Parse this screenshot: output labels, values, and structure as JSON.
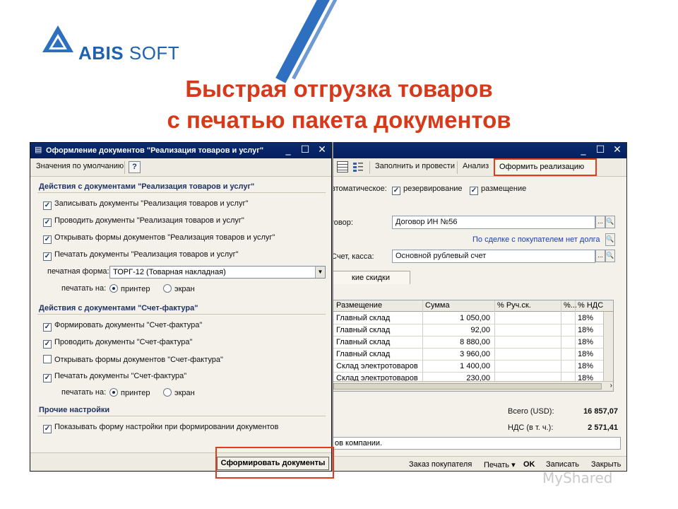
{
  "logo": {
    "brand": "ABIS",
    "suffix": "SOFT"
  },
  "slide": {
    "title_line1": "Быстрая  отгрузка товаров",
    "title_line2": "с печатью пакета документов"
  },
  "main_window": {
    "toolbar": {
      "fill_post": "Заполнить и провести",
      "analysis": "Анализ",
      "issue_sale": "Оформить реализацию"
    },
    "auto_label": "втоматическое:",
    "reserve_label": "резервирование",
    "placement_label": "размещение",
    "contract_label": "говор:",
    "contract_value": "Договор ИН №56",
    "deal_link": "По сделке с покупателем нет долга",
    "account_label": "Счет, касса:",
    "account_value": "Основной рублевый счет",
    "tab_discounts": "кие скидки",
    "table": {
      "headers": [
        "Размещение",
        "Сумма",
        "% Руч.ск.",
        "%...",
        "% НДС"
      ],
      "rows": [
        [
          "Главный склад",
          "1 050,00",
          "",
          "",
          "18%"
        ],
        [
          "Главный склад",
          "92,00",
          "",
          "",
          "18%"
        ],
        [
          "Главный склад",
          "8 880,00",
          "",
          "",
          "18%"
        ],
        [
          "Главный склад",
          "3 960,00",
          "",
          "",
          "18%"
        ],
        [
          "Склад электротоваров",
          "1 400,00",
          "",
          "",
          "18%"
        ],
        [
          "Склад электротоваров",
          "230,00",
          "",
          "",
          "18%"
        ]
      ]
    },
    "total_label": "Всего (USD):",
    "total_value": "16 857,07",
    "vat_label": "НДС (в т. ч.):",
    "vat_value": "2 571,41",
    "comment": "ов компании.",
    "bottom": {
      "customer_order": "Заказ покупателя",
      "print": "Печать",
      "ok": "OK",
      "save": "Записать",
      "close": "Закрыть"
    }
  },
  "dialog": {
    "title": "Оформление документов \"Реализация товаров и услуг\"",
    "defaults": "Значения по умолчанию",
    "help": "?",
    "section1": "Действия с документами \"Реализация товаров и услуг\"",
    "s1_opts": [
      {
        "label": "Записывать документы \"Реализация товаров и услуг\"",
        "checked": true
      },
      {
        "label": "Проводить документы \"Реализация товаров и услуг\"",
        "checked": true
      },
      {
        "label": "Открывать формы документов \"Реализация товаров и услуг\"",
        "checked": true
      },
      {
        "label": "Печатать документы \"Реализация товаров и услуг\"",
        "checked": true
      }
    ],
    "print_form_label": "печатная форма:",
    "print_form_value": "ТОРГ-12 (Товарная накладная)",
    "print_on_label": "печатать на:",
    "printer": "принтер",
    "screen": "экран",
    "section2": "Действия с документами \"Счет-фактура\"",
    "s2_opts": [
      {
        "label": "Формировать документы \"Счет-фактура\"",
        "checked": true
      },
      {
        "label": "Проводить документы \"Счет-фактура\"",
        "checked": true
      },
      {
        "label": "Открывать формы документов \"Счет-фактура\"",
        "checked": false
      },
      {
        "label": "Печатать документы \"Счет-фактура\"",
        "checked": true
      }
    ],
    "section3": "Прочие настройки",
    "s3_opt": "Показывать форму настройки при формировании документов",
    "make_button": "Сформировать документы"
  },
  "watermark": "MyShared",
  "colors": {
    "accent": "#d63a1b",
    "titlebar": "#0b2a73",
    "brand": "#1d62b0"
  }
}
